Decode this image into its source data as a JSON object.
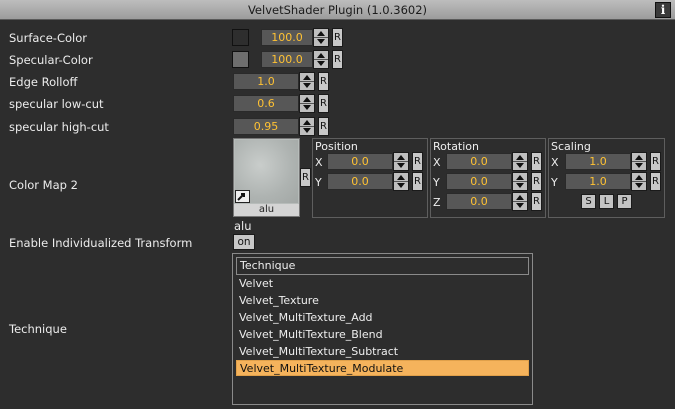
{
  "window": {
    "title": "VelvetShader Plugin (1.0.3602)",
    "info_glyph": "i"
  },
  "labels": {
    "surface_color": "Surface-Color",
    "specular_color": "Specular-Color",
    "edge_rolloff": "Edge Rolloff",
    "specular_low_cut": "specular low-cut",
    "specular_high_cut": "specular high-cut",
    "color_map_2": "Color Map 2",
    "enable_transform": "Enable Individualized Transform",
    "technique": "Technique"
  },
  "colors": {
    "surface_swatch": "#2e2e2e",
    "specular_swatch": "#6e6e6e",
    "accent": "#ffc233",
    "selection": "#f5b35c"
  },
  "values": {
    "surface_color": "100.0",
    "specular_color": "100.0",
    "edge_rolloff": "1.0",
    "specular_low_cut": "0.6",
    "specular_high_cut": "0.95"
  },
  "reset_label": "R",
  "color_map": {
    "texture_name": "alu",
    "texture_caption": "alu",
    "position": {
      "title": "Position",
      "x_label": "X",
      "y_label": "Y",
      "x": "0.0",
      "y": "0.0"
    },
    "rotation": {
      "title": "Rotation",
      "x_label": "X",
      "y_label": "Y",
      "z_label": "Z",
      "x": "0.0",
      "y": "0.0",
      "z": "0.0"
    },
    "scaling": {
      "title": "Scaling",
      "x_label": "X",
      "y_label": "Y",
      "x": "1.0",
      "y": "1.0",
      "buttons": [
        "S",
        "L",
        "P"
      ]
    }
  },
  "enable_transform": {
    "state": "on"
  },
  "technique_list": {
    "header": "Technique",
    "items": [
      "Velvet",
      "Velvet_Texture",
      "Velvet_MultiTexture_Add",
      "Velvet_MultiTexture_Blend",
      "Velvet_MultiTexture_Subtract",
      "Velvet_MultiTexture_Modulate"
    ],
    "selected_index": 5
  }
}
